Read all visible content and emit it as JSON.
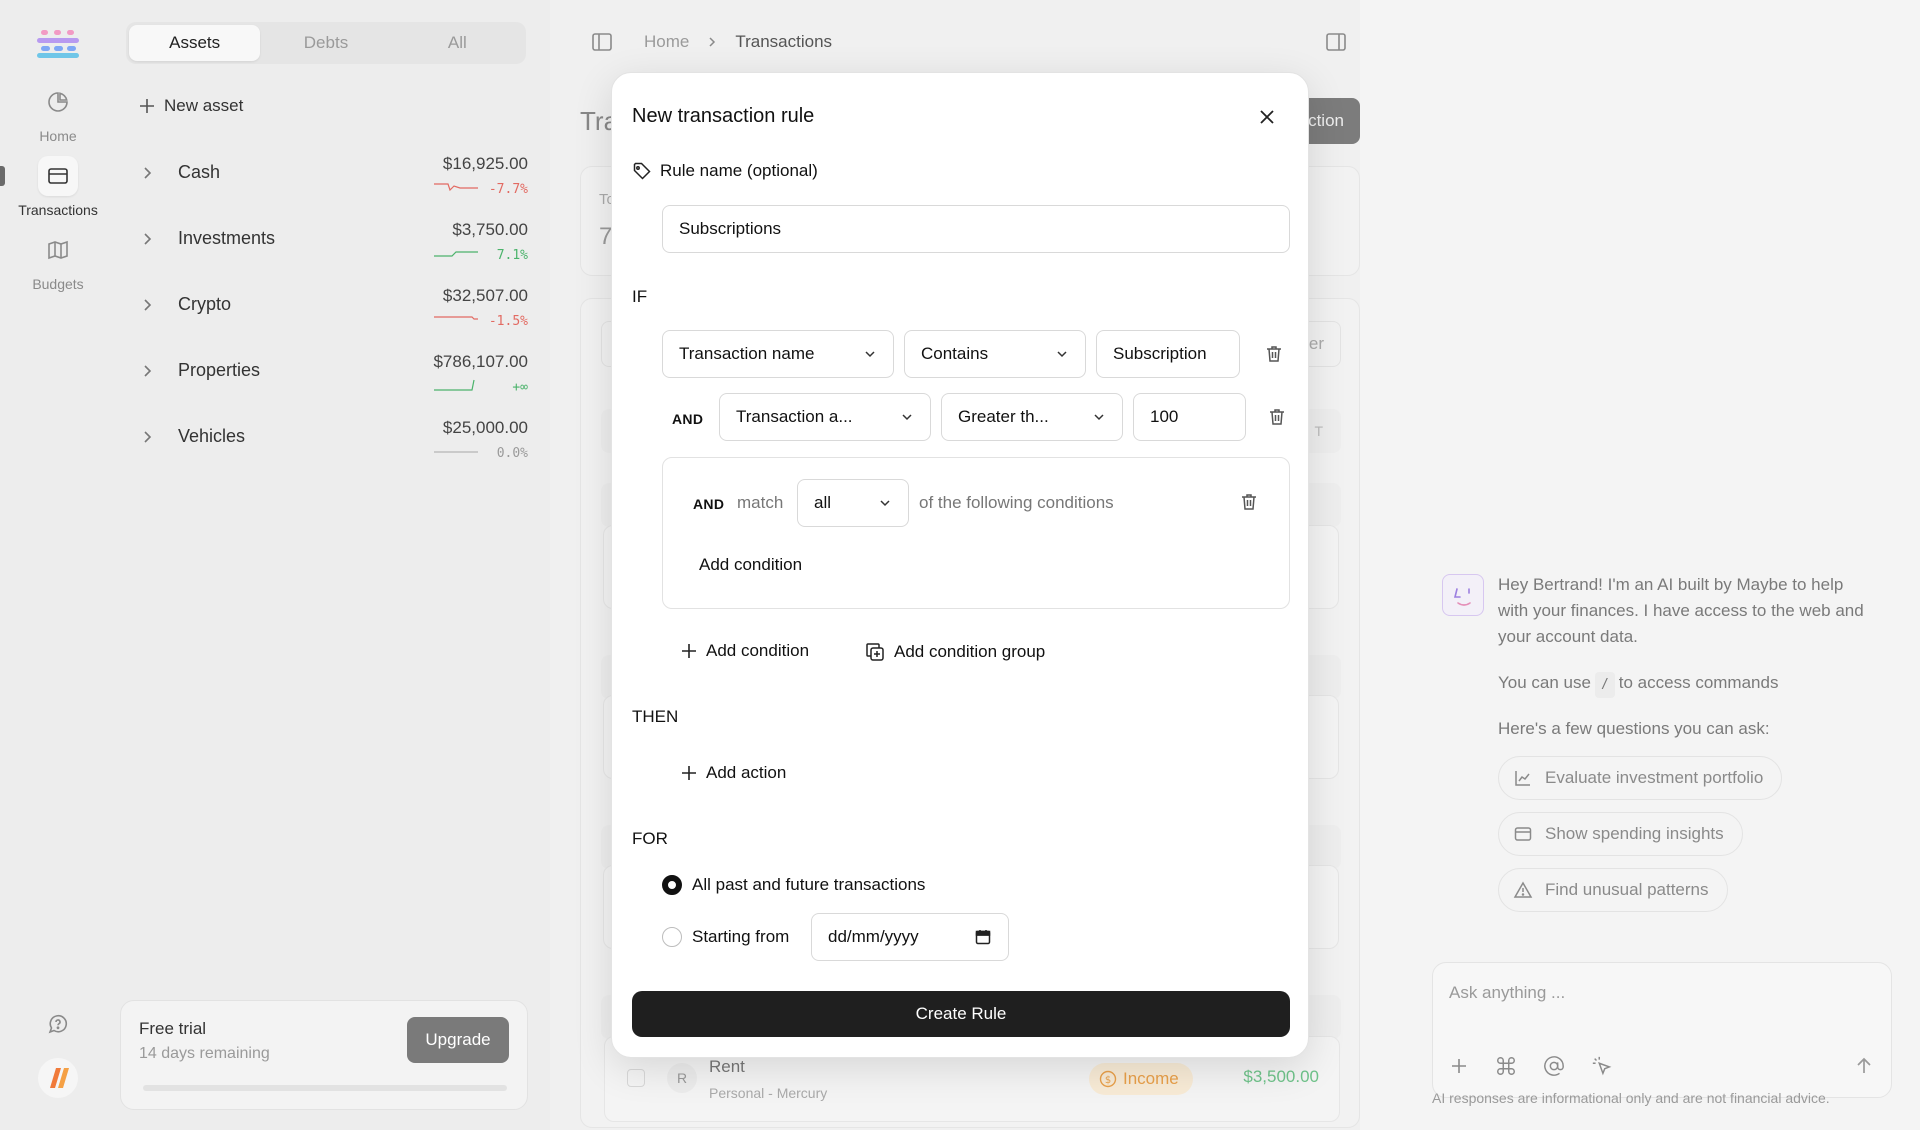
{
  "rail": {
    "items": [
      {
        "label": "Home",
        "icon": "pie-chart-icon"
      },
      {
        "label": "Transactions",
        "icon": "credit-card-icon"
      },
      {
        "label": "Budgets",
        "icon": "map-icon"
      }
    ]
  },
  "accounts": {
    "tabs": [
      "Assets",
      "Debts",
      "All"
    ],
    "active_tab": "Assets",
    "new_asset_label": "New asset",
    "rows": [
      {
        "name": "Cash",
        "amount": "$16,925.00",
        "change": "-7.7%",
        "trend": "neg"
      },
      {
        "name": "Investments",
        "amount": "$3,750.00",
        "change": "7.1%",
        "trend": "pos"
      },
      {
        "name": "Crypto",
        "amount": "$32,507.00",
        "change": "-1.5%",
        "trend": "neg"
      },
      {
        "name": "Properties",
        "amount": "$786,107.00",
        "change": "+∞",
        "trend": "pos"
      },
      {
        "name": "Vehicles",
        "amount": "$25,000.00",
        "change": "0.0%",
        "trend": "flat"
      }
    ],
    "trial": {
      "title": "Free trial",
      "subtitle": "14 days remaining",
      "button": "Upgrade"
    }
  },
  "main": {
    "breadcrumb": {
      "home": "Home",
      "current": "Transactions"
    },
    "title_partial": "Tra",
    "action_partial": "ction",
    "stat_partial": "To",
    "stat_value_partial": "7",
    "filter_partial": "er",
    "col_partial": "T",
    "rent_row": {
      "avatar": "R",
      "name": "Rent",
      "sub": "Personal - Mercury",
      "tag": "Income",
      "amount": "$3,500.00"
    }
  },
  "assistant": {
    "greeting": "Hey Bertrand! I'm an AI built by Maybe to help with your finances. I have access to the web and your account data.",
    "commands_prefix": "You can use",
    "commands_key": "/",
    "commands_suffix": "to access commands",
    "questions_intro": "Here's a few questions you can ask:",
    "suggestions": [
      {
        "label": "Evaluate investment portfolio",
        "icon": "chart-line-icon"
      },
      {
        "label": "Show spending insights",
        "icon": "wallet-icon"
      },
      {
        "label": "Find unusual patterns",
        "icon": "alert-triangle-icon"
      }
    ],
    "input_placeholder": "Ask anything ...",
    "disclaimer": "AI responses are informational only and are not financial advice."
  },
  "modal": {
    "title": "New transaction rule",
    "rule_name_label": "Rule name (optional)",
    "rule_name_value": "Subscriptions",
    "if_label": "IF",
    "condition1": {
      "field": "Transaction name",
      "operator": "Contains",
      "value": "Subscription"
    },
    "condition2": {
      "joiner": "AND",
      "field": "Transaction a...",
      "operator": "Greater th...",
      "value": "100"
    },
    "group": {
      "joiner": "AND",
      "match_label": "match",
      "match_value": "all",
      "suffix": "of the following conditions",
      "add_condition": "Add condition"
    },
    "add_condition": "Add condition",
    "add_condition_group": "Add condition group",
    "then_label": "THEN",
    "add_action": "Add action",
    "for_label": "FOR",
    "option_all": "All past and future transactions",
    "option_starting": "Starting from",
    "date_placeholder": "dd/mm/yyyy",
    "submit": "Create Rule"
  },
  "colors": {
    "accent_dark": "#1f1f1f",
    "negative": "#e26a62",
    "positive": "#4bb36b",
    "income_tag": "#e9a04a"
  }
}
